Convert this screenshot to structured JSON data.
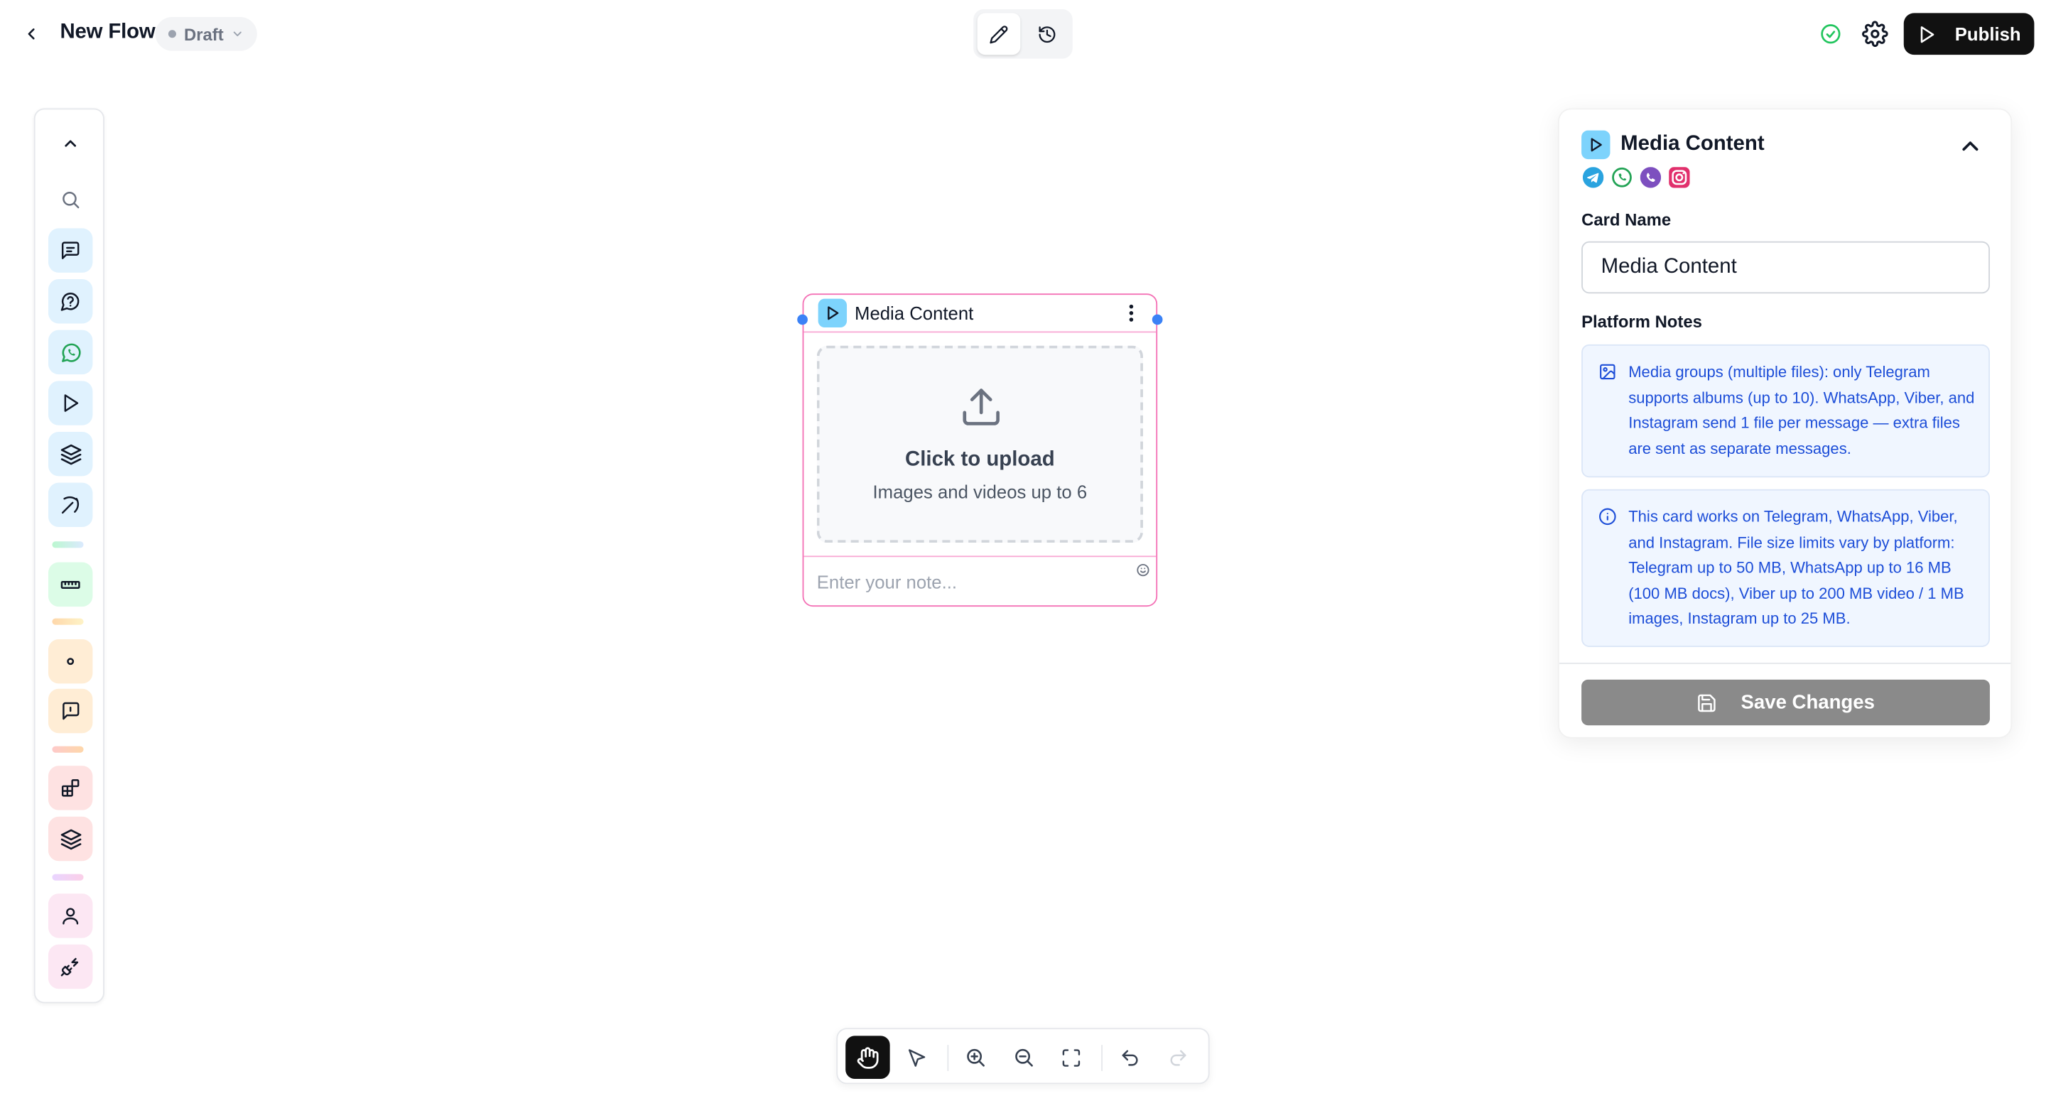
{
  "header": {
    "title": "New Flow",
    "status": "Draft",
    "publish_label": "Publish",
    "icons": [
      "back-arrow-icon",
      "chevron-down-icon",
      "pencil-icon",
      "history-icon",
      "check-circle-icon",
      "gear-icon",
      "play-icon"
    ]
  },
  "toolbar": {
    "items": [
      "chevron-up-icon",
      "search-icon",
      "message-icon",
      "question-bubble-icon",
      "whatsapp-icon",
      "play-icon",
      "layers-icon",
      "pickaxe-icon",
      "ruler-icon",
      "dot-icon",
      "message-square-icon",
      "blocks-icon",
      "layers-icon",
      "user-icon",
      "plug-icon"
    ]
  },
  "card": {
    "title": "Media Content",
    "upload_title": "Click to upload",
    "upload_sub": "Images and videos up to 6",
    "note_placeholder": "Enter your note..."
  },
  "panel": {
    "title": "Media Content",
    "platforms": [
      "telegram-icon",
      "whatsapp-icon",
      "viber-icon",
      "instagram-icon"
    ],
    "card_name_label": "Card Name",
    "card_name_value": "Media Content",
    "platform_notes_label": "Platform Notes",
    "notes": [
      "Media groups (multiple files): only Telegram supports albums (up to 10). WhatsApp, Viber, and Instagram send 1 file per message — extra files are sent as separate messages.",
      "This card works on Telegram, WhatsApp, Viber, and Instagram. File size limits vary by platform: Telegram up to 50 MB, WhatsApp up to 16 MB (100 MB docs), Viber up to 200 MB video / 1 MB images, Instagram up to 25 MB."
    ],
    "save_label": "Save Changes"
  },
  "bottom_toolbar": {
    "items": [
      "hand-icon",
      "pointer-icon",
      "zoom-in-icon",
      "zoom-out-icon",
      "fit-view-icon",
      "undo-icon",
      "redo-icon"
    ]
  },
  "colors": {
    "card_border": "#f472b6",
    "handle": "#3b82f6",
    "note_text": "#1d4ed8",
    "note_bg": "#f0f6ff",
    "publish_bg": "#111111",
    "save_bg": "#8a8a8a"
  }
}
